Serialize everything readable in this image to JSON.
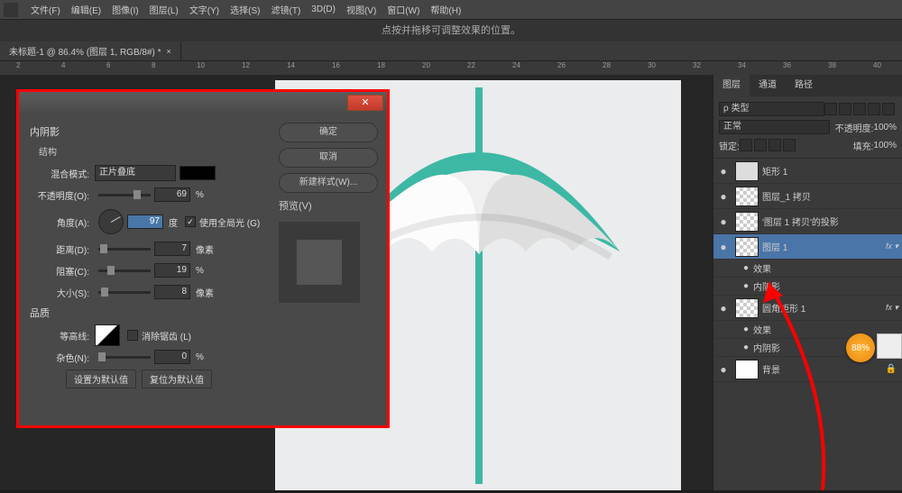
{
  "menu": [
    "文件(F)",
    "编辑(E)",
    "图像(I)",
    "图层(L)",
    "文字(Y)",
    "选择(S)",
    "滤镜(T)",
    "3D(D)",
    "视图(V)",
    "窗口(W)",
    "帮助(H)"
  ],
  "notice": "点按并拖移可调整效果的位置。",
  "tab": {
    "title": "未标题-1 @ 86.4% (图层 1, RGB/8#) *",
    "close": "×"
  },
  "ruler_ticks": [
    "2",
    "4",
    "6",
    "8",
    "10",
    "12",
    "14",
    "16",
    "18",
    "20",
    "22",
    "24",
    "26",
    "28",
    "30",
    "32",
    "34",
    "36",
    "38",
    "40"
  ],
  "dlg": {
    "close": "✕",
    "title": "内阴影",
    "sec_struct": "结构",
    "blend_lbl": "混合模式:",
    "blend_val": "正片叠底",
    "opacity_lbl": "不透明度(O):",
    "opacity_val": "69",
    "opacity_unit": "%",
    "angle_lbl": "角度(A):",
    "angle_val": "97",
    "angle_unit": "度",
    "global_lbl": "使用全局光 (G)",
    "dist_lbl": "距离(D):",
    "dist_val": "7",
    "dist_unit": "像素",
    "choke_lbl": "阻塞(C):",
    "choke_val": "19",
    "choke_unit": "%",
    "size_lbl": "大小(S):",
    "size_val": "8",
    "size_unit": "像素",
    "sec_quality": "品质",
    "contour_lbl": "等高线:",
    "antialias": "消除锯齿 (L)",
    "noise_lbl": "杂色(N):",
    "noise_val": "0",
    "noise_unit": "%",
    "btn_default": "设置为默认值",
    "btn_reset": "复位为默认值",
    "ok": "确定",
    "cancel": "取消",
    "new_style": "新建样式(W)...",
    "preview": "预览(V)"
  },
  "panels": {
    "tabs": [
      "图层",
      "通道",
      "路径"
    ],
    "kind": "ρ 类型",
    "blend": "正常",
    "opacity_lbl": "不透明度:",
    "opacity": "100%",
    "lock_lbl": "锁定:",
    "fill_lbl": "填充:",
    "fill": "100%",
    "layers": [
      {
        "name": "矩形 1",
        "eye": "●",
        "checker": false
      },
      {
        "name": "图层_1 拷贝",
        "eye": "●",
        "checker": true
      },
      {
        "name": "'图层 1 拷贝'的投影",
        "eye": "●",
        "checker": true
      },
      {
        "name": "图层 1",
        "eye": "●",
        "checker": true,
        "sel": true,
        "fx": "fx ▾"
      },
      {
        "name": "圆角矩形 1",
        "eye": "●",
        "checker": true,
        "fx": "fx ▾"
      },
      {
        "name": "背景",
        "eye": "●",
        "checker": false,
        "lock": "🔒"
      }
    ],
    "fx_label": "效果",
    "inner_shadow": "内阴影"
  },
  "badge": "88%"
}
